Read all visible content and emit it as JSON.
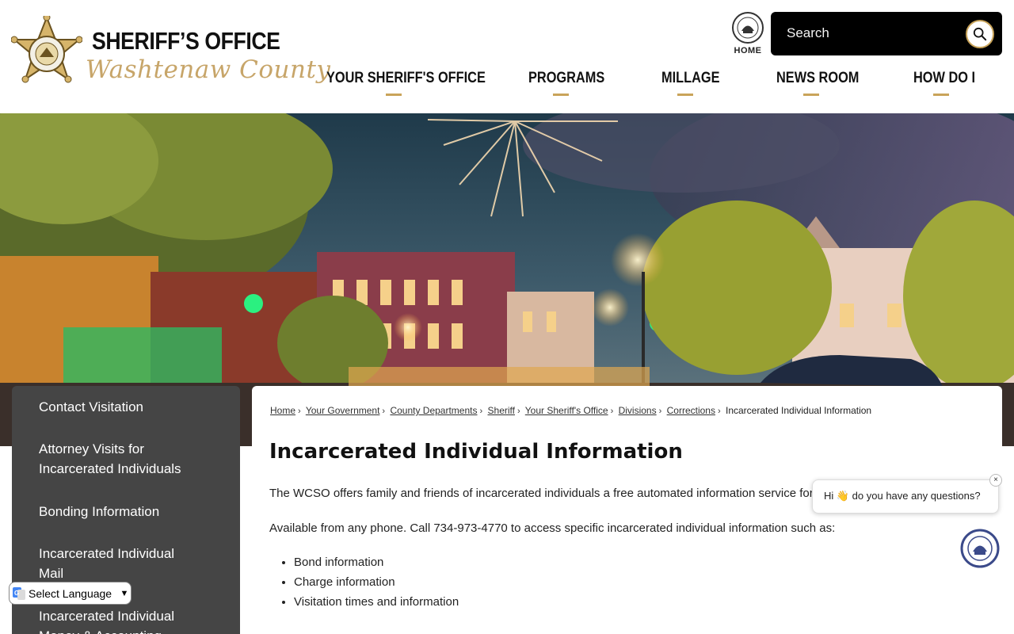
{
  "header": {
    "logo_title": "SHERIFF’S OFFICE",
    "logo_subtitle": "Washtenaw County",
    "home_label": "HOME",
    "search_placeholder": "Search"
  },
  "nav": {
    "items": [
      {
        "label": "YOUR SHERIFF'S OFFICE"
      },
      {
        "label": "PROGRAMS"
      },
      {
        "label": "MILLAGE"
      },
      {
        "label": "NEWS ROOM"
      },
      {
        "label": "HOW DO I"
      }
    ]
  },
  "sidebar": {
    "items": [
      {
        "label": "Contact Visitation"
      },
      {
        "label": "Attorney Visits for Incarcerated Individuals"
      },
      {
        "label": "Bonding Information"
      },
      {
        "label": "Incarcerated Individual Mail"
      },
      {
        "label": "Incarcerated Individual Money & Accounting"
      }
    ]
  },
  "breadcrumb": {
    "links": [
      "Home",
      "Your Government",
      "County Departments",
      "Sheriff",
      "Your Sheriff's Office",
      "Divisions",
      "Corrections"
    ],
    "current": "Incarcerated Individual Information"
  },
  "main": {
    "title": "Incarcerated Individual Information",
    "paragraph1": "The WCSO offers family and friends of incarcerated individuals a free automated information service for",
    "paragraph2": "Available from any phone. Call 734-973-4770 to access specific incarcerated individual information such as:",
    "bullets": [
      "Bond information",
      "Charge information",
      "Visitation times and information"
    ]
  },
  "chat": {
    "greeting": "Hi 👋 do you have any questions?",
    "close_glyph": "×"
  },
  "translate": {
    "selected": "Select Language"
  },
  "colors": {
    "accent_gold": "#c9a45a",
    "sidebar_bg": "#454545",
    "search_bg": "#000000"
  }
}
